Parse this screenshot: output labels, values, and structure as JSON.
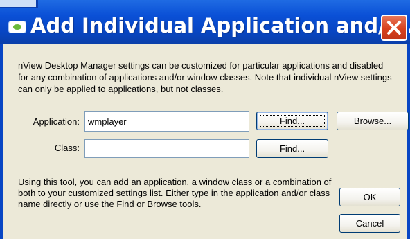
{
  "window": {
    "title": "Add Individual Application and/o...",
    "colors": {
      "titlebar": "#0846c4",
      "panel": "#ece9d8",
      "close_button": "#d8411e"
    },
    "icons": [
      "nview-app-icon",
      "close-icon"
    ]
  },
  "description": "nView Desktop Manager settings can be customized for particular applications and disabled for any combination of applications and/or window classes. Note that individual nView settings can only be applied to applications, but not classes.",
  "form": {
    "application_label": "Application:",
    "application_value": "wmplayer",
    "class_label": "Class:",
    "class_value": ""
  },
  "buttons": {
    "find_app": "Find...",
    "browse": "Browse...",
    "find_class": "Find...",
    "ok": "OK",
    "cancel": "Cancel"
  },
  "help_text": "Using this tool, you can add an application, a window class or a combination of both to your customized settings list. Either type in the application and/or class name directly or use the Find or Browse tools."
}
